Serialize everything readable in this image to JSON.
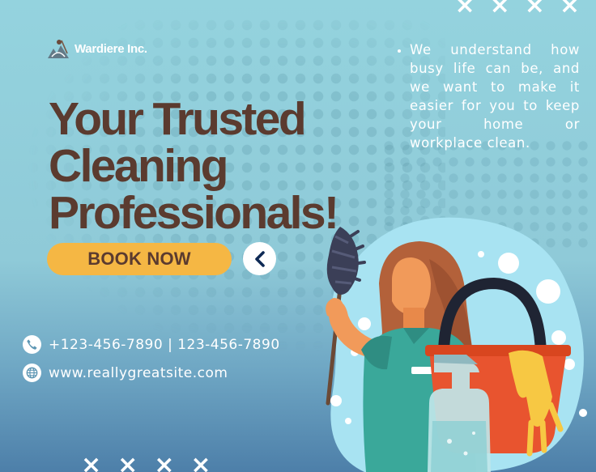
{
  "brand": {
    "name": "Wardiere Inc."
  },
  "intro": {
    "text": "We understand how busy life can be, and we want to make it easier for you to keep your home or workplace clean."
  },
  "headline": {
    "line1": "Your Trusted",
    "line2": "Cleaning",
    "line3": "Professionals!"
  },
  "cta": {
    "book_label": "BOOK NOW"
  },
  "contact": {
    "phone": "+123-456-7890 | 123-456-7890",
    "website": "www.reallygreatsite.com"
  },
  "decor": {
    "cross": "×"
  },
  "colors": {
    "background": "#94d3de",
    "headline": "#5b3b2f",
    "button": "#f5b744",
    "bucket": "#e8542f",
    "glove": "#f7c843",
    "shirt": "#3aa89a"
  },
  "icons": {
    "phone": "phone-icon",
    "web": "globe-icon",
    "back": "chevron-left-icon"
  }
}
